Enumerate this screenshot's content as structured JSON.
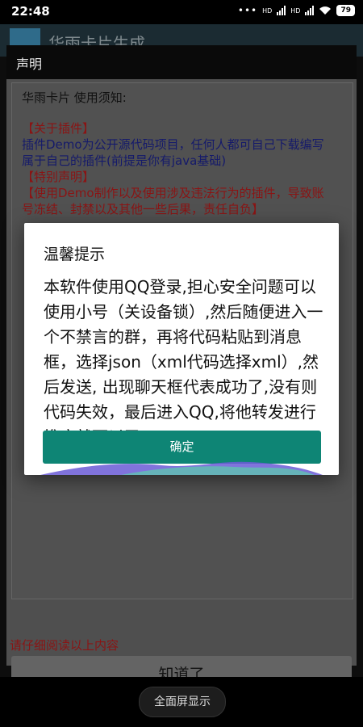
{
  "status_bar": {
    "time": "22:48",
    "signal_label": "HD",
    "battery": "79"
  },
  "app_bar": {
    "title": "华雨卡片生成"
  },
  "notice": {
    "title": "声明",
    "lines": [
      {
        "text": "华雨卡片 使用须知:",
        "color": "black"
      },
      {
        "text": "【关于插件】",
        "color": "red"
      },
      {
        "text": "插件Demo为公开源代码项目，任何人都可自己下载编写",
        "color": "blue"
      },
      {
        "text": "属于自己的插件(前提是你有java基础)",
        "color": "blue"
      },
      {
        "text": "【特别声明】",
        "color": "red"
      },
      {
        "text": "【使用Demo制作以及使用涉及违法行为的插件，导致账",
        "color": "red"
      },
      {
        "text": "号冻结、封禁以及其他一些后果，责任自负】",
        "color": "red"
      }
    ],
    "footer_note": "请仔细阅读以上内容",
    "confirm_label": "知道了"
  },
  "alert": {
    "title": "温馨提示",
    "message": "本软件使用QQ登录,担心安全问题可以使用小号（关设备锁）,然后随便进入一个不禁言的群，再将代码粘贴到消息框，选择json（xml代码选择xml）,然后发送, 出现聊天框代表成功了,没有则代码失效，最后进入QQ,将他转发进行推广就可以了！",
    "ok_label": "确定"
  },
  "bottom_bar": {
    "fullscreen_label": "全面屏显示"
  },
  "colors": {
    "accent": "#0e8575",
    "notice_red": "#8a1414",
    "notice_blue": "#151a6a"
  }
}
